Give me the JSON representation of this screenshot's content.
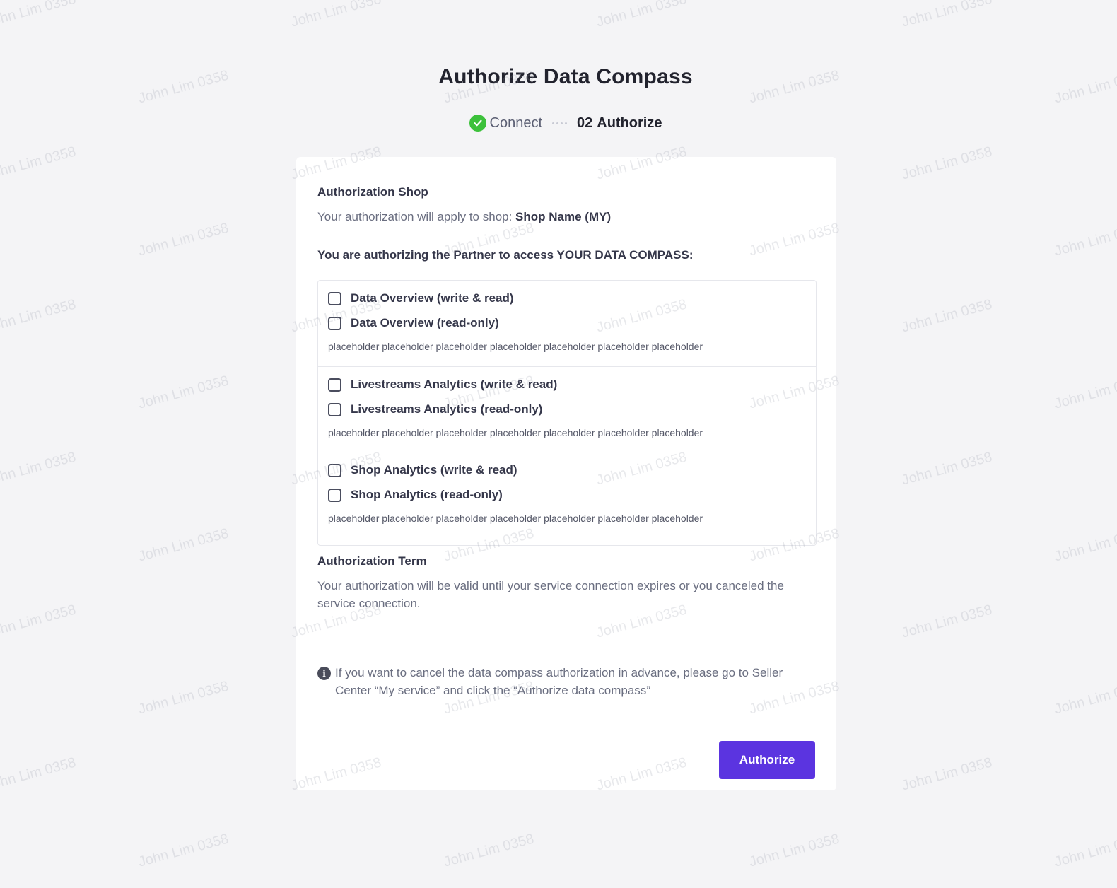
{
  "page": {
    "title": "Authorize Data Compass"
  },
  "stepper": {
    "step1": {
      "label": "Connect",
      "status": "completed",
      "icon": "check-circle-icon",
      "color": "#3cc13b"
    },
    "step2": {
      "number": "02",
      "label": "Authorize",
      "status": "current"
    }
  },
  "shop_section": {
    "heading": "Authorization Shop",
    "text_prefix": "Your authorization will apply to shop: ",
    "shop_name": "Shop Name (MY)"
  },
  "access_heading": "You are authorizing the Partner to access YOUR DATA COMPASS:",
  "permission_groups": [
    {
      "options": [
        {
          "label": "Data Overview (write & read)",
          "checked": false
        },
        {
          "label": "Data Overview (read-only)",
          "checked": false
        }
      ],
      "description": "placeholder placeholder placeholder placeholder placeholder placeholder placeholder"
    },
    {
      "options": [
        {
          "label": "Livestreams Analytics (write & read)",
          "checked": false
        },
        {
          "label": "Livestreams Analytics (read-only)",
          "checked": false
        }
      ],
      "description": "placeholder placeholder placeholder placeholder placeholder placeholder placeholder"
    },
    {
      "options": [
        {
          "label": "Shop Analytics (write & read)",
          "checked": false
        },
        {
          "label": "Shop Analytics (read-only)",
          "checked": false
        }
      ],
      "description": "placeholder placeholder placeholder placeholder placeholder placeholder placeholder"
    }
  ],
  "term_section": {
    "heading": "Authorization Term",
    "text_line1": "Your authorization will be valid until your service connection expires or you canceled the",
    "text_line2": "service connection."
  },
  "notice": {
    "icon": "info-icon",
    "text_line1": "If you want to cancel the data compass authorization in advance, please go to Seller",
    "text_line2": "Center “My service” and click the “Authorize data compass”"
  },
  "actions": {
    "authorize_label": "Authorize",
    "authorize_color": "#5b34e0"
  },
  "watermark": {
    "text": "John Lim 0358"
  }
}
